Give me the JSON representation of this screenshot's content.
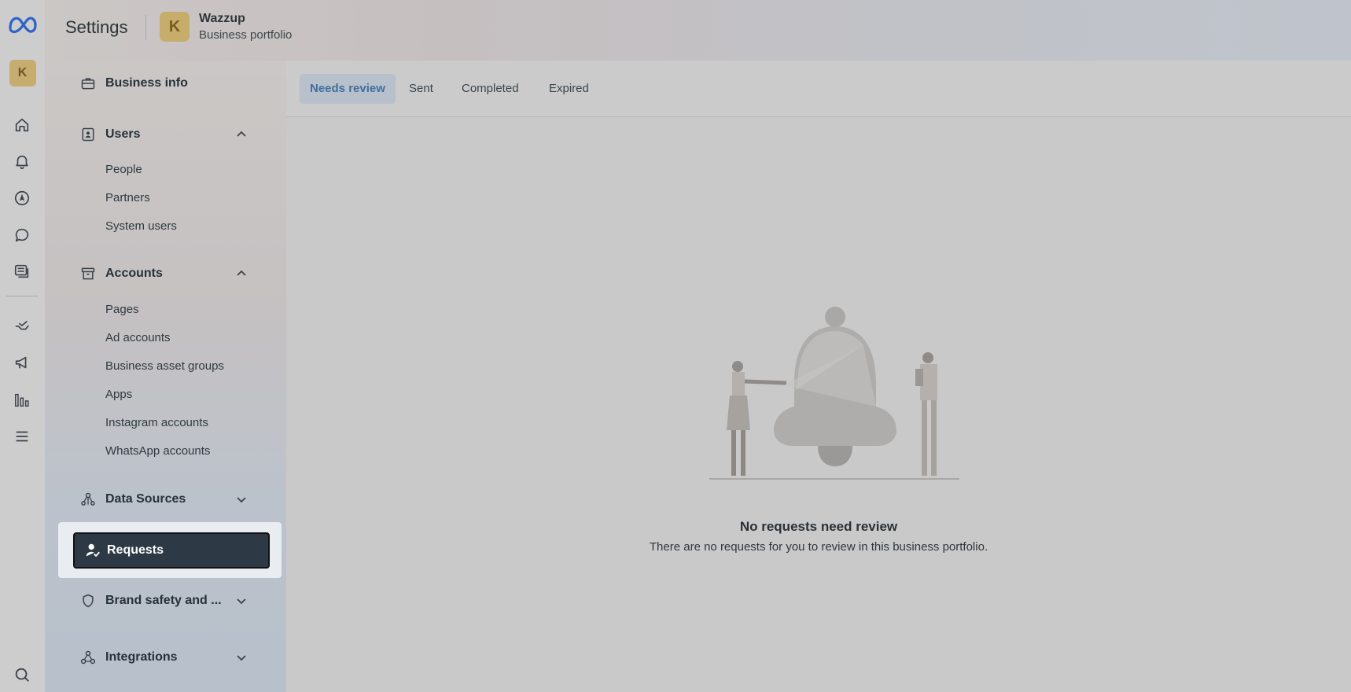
{
  "header": {
    "title": "Settings",
    "business_avatar_letter": "K",
    "business_name": "Wazzup",
    "business_subtitle": "Business portfolio"
  },
  "rail": {
    "avatar_letter": "K",
    "icons": [
      "meta-logo-icon",
      "home-icon",
      "bell-icon",
      "compass-icon",
      "chat-icon",
      "content-icon",
      "hand-icon",
      "megaphone-icon",
      "bar-chart-icon",
      "menu-icon",
      "search-icon"
    ]
  },
  "sidebar": {
    "business_info": "Business info",
    "users": {
      "label": "Users",
      "items": [
        "People",
        "Partners",
        "System users"
      ]
    },
    "accounts": {
      "label": "Accounts",
      "items": [
        "Pages",
        "Ad accounts",
        "Business asset groups",
        "Apps",
        "Instagram accounts",
        "WhatsApp accounts"
      ]
    },
    "data_sources": "Data Sources",
    "requests": "Requests",
    "brand_safety": "Brand safety and ...",
    "integrations": "Integrations"
  },
  "tabs": [
    {
      "label": "Needs review",
      "active": true
    },
    {
      "label": "Sent",
      "active": false
    },
    {
      "label": "Completed",
      "active": false
    },
    {
      "label": "Expired",
      "active": false
    }
  ],
  "empty_state": {
    "title": "No requests need review",
    "description": "There are no requests for you to review in this business portfolio."
  },
  "colors": {
    "active_tab_text": "#3f6e9f",
    "active_tab_bg": "#b8c1cb",
    "requests_bg": "#2d3a45",
    "avatar_bg": "#c7ad6a"
  }
}
